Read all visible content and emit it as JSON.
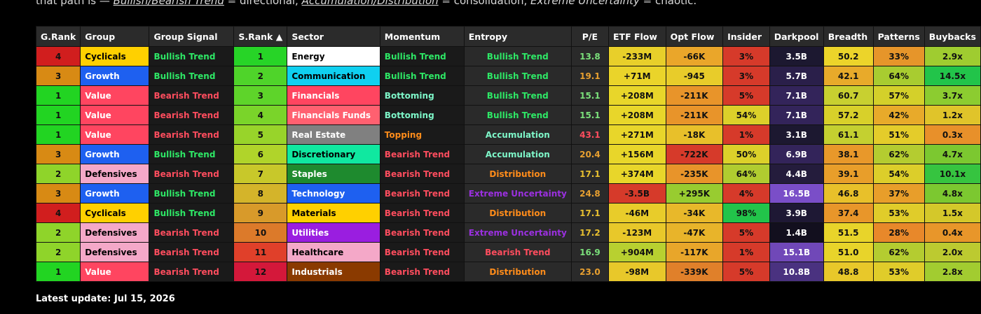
{
  "intro": {
    "prefix": "that path is — ",
    "link1": "Bullish/Bearish Trend",
    "mid1": " = directional, ",
    "link2": "Accumulation/Distribution",
    "mid2": " = consolidation, ",
    "link3": "Extreme Uncertainty",
    "suffix": " = chaotic."
  },
  "colors": {
    "green_text": "#2ee866",
    "red_text": "#ff4d5e",
    "orange_text": "#ff8c1a",
    "purple_text": "#9b30e0",
    "teal_text": "#7ef7c9"
  },
  "headers": [
    "G.Rank",
    "Group",
    "Group Signal",
    "S.Rank ▲",
    "Sector",
    "Momentum",
    "Entropy",
    "P/E",
    "ETF Flow",
    "Opt Flow",
    "Insider",
    "Darkpool",
    "Breadth",
    "Patterns",
    "Buybacks"
  ],
  "rows": [
    {
      "grank": "4",
      "grank_bg": "#d11e1e",
      "group": "Cyclicals",
      "group_bg": "#ffd000",
      "group_fg": "#000",
      "signal": "Bullish Trend",
      "signal_fg": "#2ee866",
      "srank": "1",
      "srank_bg": "#27d427",
      "sector": "Energy",
      "sector_bg": "#ffffff",
      "sector_fg": "#000",
      "momentum": "Bullish Trend",
      "mom_fg": "#2ee866",
      "entropy": "Bullish Trend",
      "ent_fg": "#2ee866",
      "pe": "13.8",
      "pe_fg": "#7be07b",
      "etf": "-233M",
      "etf_bg": "#e8cf2a",
      "opt": "-66K",
      "opt_bg": "#eaa62a",
      "insider": "3%",
      "ins_bg": "#d63a2a",
      "darkpool": "3.5B",
      "dp_bg": "#1c1830",
      "breadth": "50.2",
      "br_bg": "#ecd42a",
      "patterns": "33%",
      "pat_bg": "#e6952a",
      "buybacks": "2.9x",
      "bb_bg": "#9fcc30"
    },
    {
      "grank": "3",
      "grank_bg": "#d88a14",
      "group": "Growth",
      "group_bg": "#1e60f0",
      "group_fg": "#fff",
      "signal": "Bullish Trend",
      "signal_fg": "#2ee866",
      "srank": "2",
      "srank_bg": "#4fd42a",
      "sector": "Communication",
      "sector_bg": "#0fd0f0",
      "sector_fg": "#000",
      "momentum": "Bullish Trend",
      "mom_fg": "#2ee866",
      "entropy": "Bullish Trend",
      "ent_fg": "#2ee866",
      "pe": "19.1",
      "pe_fg": "#e8a030",
      "etf": "+71M",
      "etf_bg": "#ead42a",
      "opt": "-945",
      "opt_bg": "#e8cc2a",
      "insider": "3%",
      "ins_bg": "#d63a2a",
      "darkpool": "5.7B",
      "dp_bg": "#2a1f4a",
      "breadth": "42.1",
      "br_bg": "#e8aa2a",
      "patterns": "64%",
      "pat_bg": "#a8cc30",
      "buybacks": "14.5x",
      "bb_bg": "#22c44a"
    },
    {
      "grank": "1",
      "grank_bg": "#22d422",
      "group": "Value",
      "group_bg": "#ff4560",
      "group_fg": "#fff",
      "signal": "Bearish Trend",
      "signal_fg": "#ff4d5e",
      "srank": "3",
      "srank_bg": "#5ed42a",
      "sector": "Financials",
      "sector_bg": "#ff4560",
      "sector_fg": "#fff",
      "momentum": "Bottoming",
      "mom_fg": "#7ef7c9",
      "entropy": "Bullish Trend",
      "ent_fg": "#2ee866",
      "pe": "15.1",
      "pe_fg": "#7be07b",
      "etf": "+208M",
      "etf_bg": "#e8d62a",
      "opt": "-211K",
      "opt_bg": "#e8942a",
      "insider": "5%",
      "ins_bg": "#d63a2a",
      "darkpool": "7.1B",
      "dp_bg": "#33245a",
      "breadth": "60.7",
      "br_bg": "#c8d030",
      "patterns": "57%",
      "pat_bg": "#d4d02a",
      "buybacks": "3.7x",
      "bb_bg": "#8ccc30"
    },
    {
      "grank": "1",
      "grank_bg": "#22d422",
      "group": "Value",
      "group_bg": "#ff4560",
      "group_fg": "#fff",
      "signal": "Bearish Trend",
      "signal_fg": "#ff4d5e",
      "srank": "4",
      "srank_bg": "#7ad42a",
      "sector": "Financials Funds",
      "sector_bg": "#ff6070",
      "sector_fg": "#fff",
      "momentum": "Bottoming",
      "mom_fg": "#7ef7c9",
      "entropy": "Bullish Trend",
      "ent_fg": "#2ee866",
      "pe": "15.1",
      "pe_fg": "#7be07b",
      "etf": "+208M",
      "etf_bg": "#e8d62a",
      "opt": "-211K",
      "opt_bg": "#e8942a",
      "insider": "54%",
      "ins_bg": "#dcd02a",
      "darkpool": "7.1B",
      "dp_bg": "#33245a",
      "breadth": "57.2",
      "br_bg": "#d8d02a",
      "patterns": "42%",
      "pat_bg": "#e8aa2a",
      "buybacks": "1.2x",
      "bb_bg": "#e0c42a"
    },
    {
      "grank": "1",
      "grank_bg": "#22d422",
      "group": "Value",
      "group_bg": "#ff4560",
      "group_fg": "#fff",
      "signal": "Bearish Trend",
      "signal_fg": "#ff4d5e",
      "srank": "5",
      "srank_bg": "#98d42a",
      "sector": "Real Estate",
      "sector_bg": "#808080",
      "sector_fg": "#fff",
      "momentum": "Topping",
      "mom_fg": "#ff8c1a",
      "entropy": "Accumulation",
      "ent_fg": "#7ef7c9",
      "pe": "43.1",
      "pe_fg": "#ff4d5e",
      "etf": "+271M",
      "etf_bg": "#e8d62a",
      "opt": "-18K",
      "opt_bg": "#e8c02a",
      "insider": "1%",
      "ins_bg": "#d63a2a",
      "darkpool": "3.1B",
      "dp_bg": "#1c1830",
      "breadth": "61.1",
      "br_bg": "#c4d030",
      "patterns": "51%",
      "pat_bg": "#e4cc2a",
      "buybacks": "0.3x",
      "bb_bg": "#e8902a"
    },
    {
      "grank": "3",
      "grank_bg": "#d88a14",
      "group": "Growth",
      "group_bg": "#1e60f0",
      "group_fg": "#fff",
      "signal": "Bullish Trend",
      "signal_fg": "#2ee866",
      "srank": "6",
      "srank_bg": "#b0d42a",
      "sector": "Discretionary",
      "sector_bg": "#10e8a0",
      "sector_fg": "#000",
      "momentum": "Bearish Trend",
      "mom_fg": "#ff4d5e",
      "entropy": "Accumulation",
      "ent_fg": "#7ef7c9",
      "pe": "20.4",
      "pe_fg": "#e8a030",
      "etf": "+156M",
      "etf_bg": "#e8d62a",
      "opt": "-722K",
      "opt_bg": "#d63a2a",
      "insider": "50%",
      "ins_bg": "#dcd02a",
      "darkpool": "6.9B",
      "dp_bg": "#33245a",
      "breadth": "38.1",
      "br_bg": "#e8982a",
      "patterns": "62%",
      "pat_bg": "#b4cc30",
      "buybacks": "4.7x",
      "bb_bg": "#7cc830"
    },
    {
      "grank": "2",
      "grank_bg": "#8fd42a",
      "group": "Defensives",
      "group_bg": "#f4a8c8",
      "group_fg": "#000",
      "signal": "Bearish Trend",
      "signal_fg": "#ff4d5e",
      "srank": "7",
      "srank_bg": "#c8c82a",
      "sector": "Staples",
      "sector_bg": "#1e8a2e",
      "sector_fg": "#fff",
      "momentum": "Bearish Trend",
      "mom_fg": "#ff4d5e",
      "entropy": "Distribution",
      "ent_fg": "#ff8c1a",
      "pe": "17.1",
      "pe_fg": "#e8c030",
      "etf": "+374M",
      "etf_bg": "#e8d62a",
      "opt": "-235K",
      "opt_bg": "#e8942a",
      "insider": "64%",
      "ins_bg": "#b0cc30",
      "darkpool": "4.4B",
      "dp_bg": "#241c3c",
      "breadth": "39.1",
      "br_bg": "#e89e2a",
      "patterns": "54%",
      "pat_bg": "#dcce2a",
      "buybacks": "10.1x",
      "bb_bg": "#36c440"
    },
    {
      "grank": "3",
      "grank_bg": "#d88a14",
      "group": "Growth",
      "group_bg": "#1e60f0",
      "group_fg": "#fff",
      "signal": "Bullish Trend",
      "signal_fg": "#2ee866",
      "srank": "8",
      "srank_bg": "#d4b42a",
      "sector": "Technology",
      "sector_bg": "#1e60f0",
      "sector_fg": "#fff",
      "momentum": "Bearish Trend",
      "mom_fg": "#ff4d5e",
      "entropy": "Extreme Uncertainty",
      "ent_fg": "#9b30e0",
      "pe": "24.8",
      "pe_fg": "#e8a030",
      "etf": "-3.5B",
      "etf_bg": "#d63a2a",
      "opt": "+295K",
      "opt_bg": "#98cc30",
      "insider": "4%",
      "ins_bg": "#d63a2a",
      "darkpool": "16.5B",
      "dp_bg": "#7a4ec8",
      "breadth": "46.8",
      "br_bg": "#e8c02a",
      "patterns": "37%",
      "pat_bg": "#e89e2a",
      "buybacks": "4.8x",
      "bb_bg": "#7cc830"
    },
    {
      "grank": "4",
      "grank_bg": "#d11e1e",
      "group": "Cyclicals",
      "group_bg": "#ffd000",
      "group_fg": "#000",
      "signal": "Bullish Trend",
      "signal_fg": "#2ee866",
      "srank": "9",
      "srank_bg": "#d89a2a",
      "sector": "Materials",
      "sector_bg": "#ffd000",
      "sector_fg": "#000",
      "momentum": "Bearish Trend",
      "mom_fg": "#ff4d5e",
      "entropy": "Distribution",
      "ent_fg": "#ff8c1a",
      "pe": "17.1",
      "pe_fg": "#e8c030",
      "etf": "-46M",
      "etf_bg": "#e8cc2a",
      "opt": "-34K",
      "opt_bg": "#e8b82a",
      "insider": "98%",
      "ins_bg": "#22c44a",
      "darkpool": "3.9B",
      "dp_bg": "#1e1834",
      "breadth": "37.4",
      "br_bg": "#e8962a",
      "patterns": "53%",
      "pat_bg": "#e0cc2a",
      "buybacks": "1.5x",
      "bb_bg": "#d4c82a"
    },
    {
      "grank": "2",
      "grank_bg": "#8fd42a",
      "group": "Defensives",
      "group_bg": "#f4a8c8",
      "group_fg": "#000",
      "signal": "Bearish Trend",
      "signal_fg": "#ff4d5e",
      "srank": "10",
      "srank_bg": "#dc7a2a",
      "sector": "Utilities",
      "sector_bg": "#9a1ee0",
      "sector_fg": "#fff",
      "momentum": "Bearish Trend",
      "mom_fg": "#ff4d5e",
      "entropy": "Extreme Uncertainty",
      "ent_fg": "#9b30e0",
      "pe": "17.2",
      "pe_fg": "#e8c030",
      "etf": "-123M",
      "etf_bg": "#e8c82a",
      "opt": "-47K",
      "opt_bg": "#e8b42a",
      "insider": "5%",
      "ins_bg": "#d63a2a",
      "darkpool": "1.4B",
      "dp_bg": "#120f1e",
      "breadth": "51.5",
      "br_bg": "#e8d42a",
      "patterns": "28%",
      "pat_bg": "#e8882a",
      "buybacks": "0.4x",
      "bb_bg": "#e8962a"
    },
    {
      "grank": "2",
      "grank_bg": "#8fd42a",
      "group": "Defensives",
      "group_bg": "#f4a8c8",
      "group_fg": "#000",
      "signal": "Bearish Trend",
      "signal_fg": "#ff4d5e",
      "srank": "11",
      "srank_bg": "#e0402a",
      "sector": "Healthcare",
      "sector_bg": "#f4a8c8",
      "sector_fg": "#000",
      "momentum": "Bearish Trend",
      "mom_fg": "#ff4d5e",
      "entropy": "Bearish Trend",
      "ent_fg": "#ff4d5e",
      "pe": "16.9",
      "pe_fg": "#7be07b",
      "etf": "+904M",
      "etf_bg": "#b8d030",
      "opt": "-117K",
      "opt_bg": "#e8a62a",
      "insider": "1%",
      "ins_bg": "#d63a2a",
      "darkpool": "15.1B",
      "dp_bg": "#7048b8",
      "breadth": "51.0",
      "br_bg": "#e8d42a",
      "patterns": "62%",
      "pat_bg": "#b4cc30",
      "buybacks": "2.0x",
      "bb_bg": "#bcca30"
    },
    {
      "grank": "1",
      "grank_bg": "#22d422",
      "group": "Value",
      "group_bg": "#ff4560",
      "group_fg": "#fff",
      "signal": "Bearish Trend",
      "signal_fg": "#ff4d5e",
      "srank": "12",
      "srank_bg": "#d4183a",
      "sector": "Industrials",
      "sector_bg": "#8a3a00",
      "sector_fg": "#fff",
      "momentum": "Bearish Trend",
      "mom_fg": "#ff4d5e",
      "entropy": "Distribution",
      "ent_fg": "#ff8c1a",
      "pe": "23.0",
      "pe_fg": "#e8a030",
      "etf": "-98M",
      "etf_bg": "#e8c82a",
      "opt": "-339K",
      "opt_bg": "#e0802a",
      "insider": "5%",
      "ins_bg": "#d63a2a",
      "darkpool": "10.8B",
      "dp_bg": "#4a3280",
      "breadth": "48.8",
      "br_bg": "#e8c82a",
      "patterns": "53%",
      "pat_bg": "#e0cc2a",
      "buybacks": "2.8x",
      "bb_bg": "#a2cc30"
    }
  ],
  "footer": "Latest update: Jul 15, 2026"
}
